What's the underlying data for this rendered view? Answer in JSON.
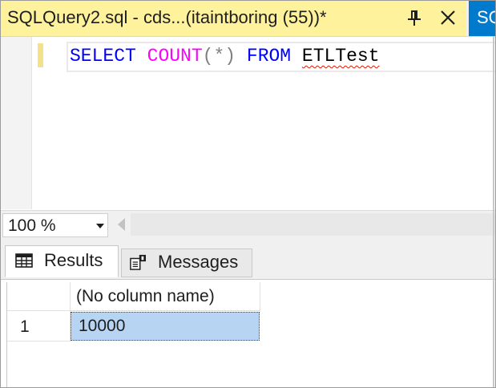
{
  "document_tab": {
    "title": "SQLQuery2.sql - cds...(itaintboring (55))*",
    "next_tab_label": "SQ"
  },
  "editor": {
    "keyword_select": "SELECT",
    "function_count": "COUNT",
    "paren_expr": "(*)",
    "keyword_from": "FROM",
    "table_name": "ETLTest"
  },
  "zoom": {
    "value": "100 %"
  },
  "result_tabs": [
    {
      "label": "Results",
      "selected": true
    },
    {
      "label": "Messages",
      "selected": false
    }
  ],
  "grid": {
    "column_header": "(No column name)",
    "rows": [
      {
        "row_number": "1",
        "value": "10000"
      }
    ]
  },
  "colors": {
    "active_tab": "#fff29d",
    "accent": "#007acc",
    "selected_cell": "#b7d5f2",
    "keyword": "#0000ff",
    "function": "#ff00ff"
  },
  "icons": [
    "pin-icon",
    "close-icon",
    "zoom-dropdown-icon",
    "scroll-left-icon",
    "results-grid-icon",
    "messages-icon"
  ]
}
